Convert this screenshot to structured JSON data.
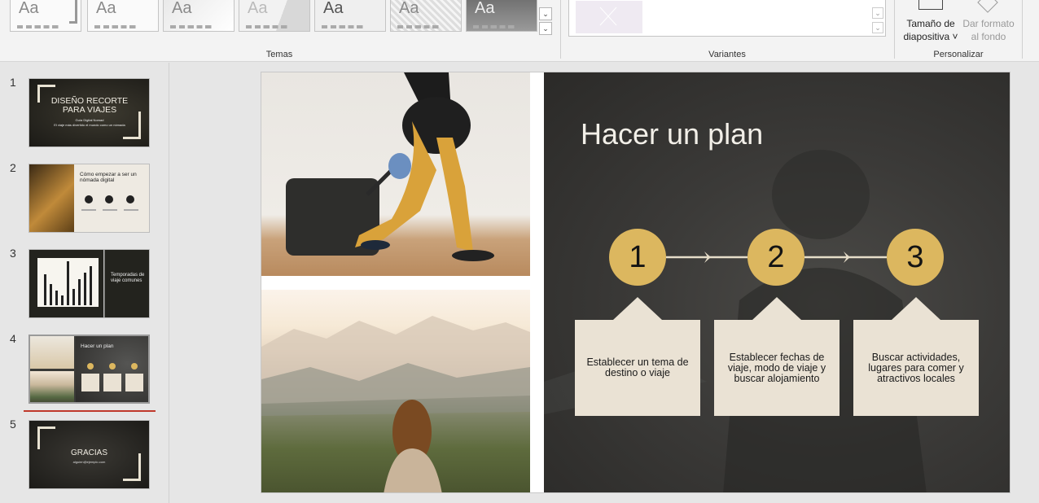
{
  "ribbon": {
    "group_themes": "Temas",
    "group_variants": "Variantes",
    "group_customize": "Personalizar",
    "theme_thumb_label": "Aa",
    "slide_size_line1": "Tamaño de",
    "slide_size_line2": "diapositiva ˅",
    "bg_format_line1": "Dar formato",
    "bg_format_line2": "al fondo"
  },
  "slides_panel": {
    "numbers": [
      "1",
      "2",
      "3",
      "4",
      "5"
    ],
    "s1_title": "DISEÑO RECORTE PARA VIAJES",
    "s1_sub1": "Guía Digital Nomad",
    "s1_sub2": "El viaje más divertido el mundo como un nómada",
    "s2_title": "Cómo empezar a ser un nómada digital",
    "s3_title": "Temporadas de viaje comunes",
    "s4_title": "Hacer un plan",
    "s5_title": "GRACIAS",
    "s5_sub": "alguien@ejemplo.com"
  },
  "slide": {
    "title": "Hacer un plan",
    "steps": [
      {
        "num": "1",
        "text": "Establecer un tema de destino o viaje"
      },
      {
        "num": "2",
        "text": "Establecer fechas de viaje, modo de viaje y buscar alojamiento"
      },
      {
        "num": "3",
        "text": "Buscar actividades, lugares para comer y atractivos locales"
      }
    ]
  },
  "colors": {
    "accent_gold": "#dcb75f",
    "card_beige": "#eae2d4",
    "slide_dark": "#3b3a38",
    "selection_marker": "#c0392b"
  }
}
